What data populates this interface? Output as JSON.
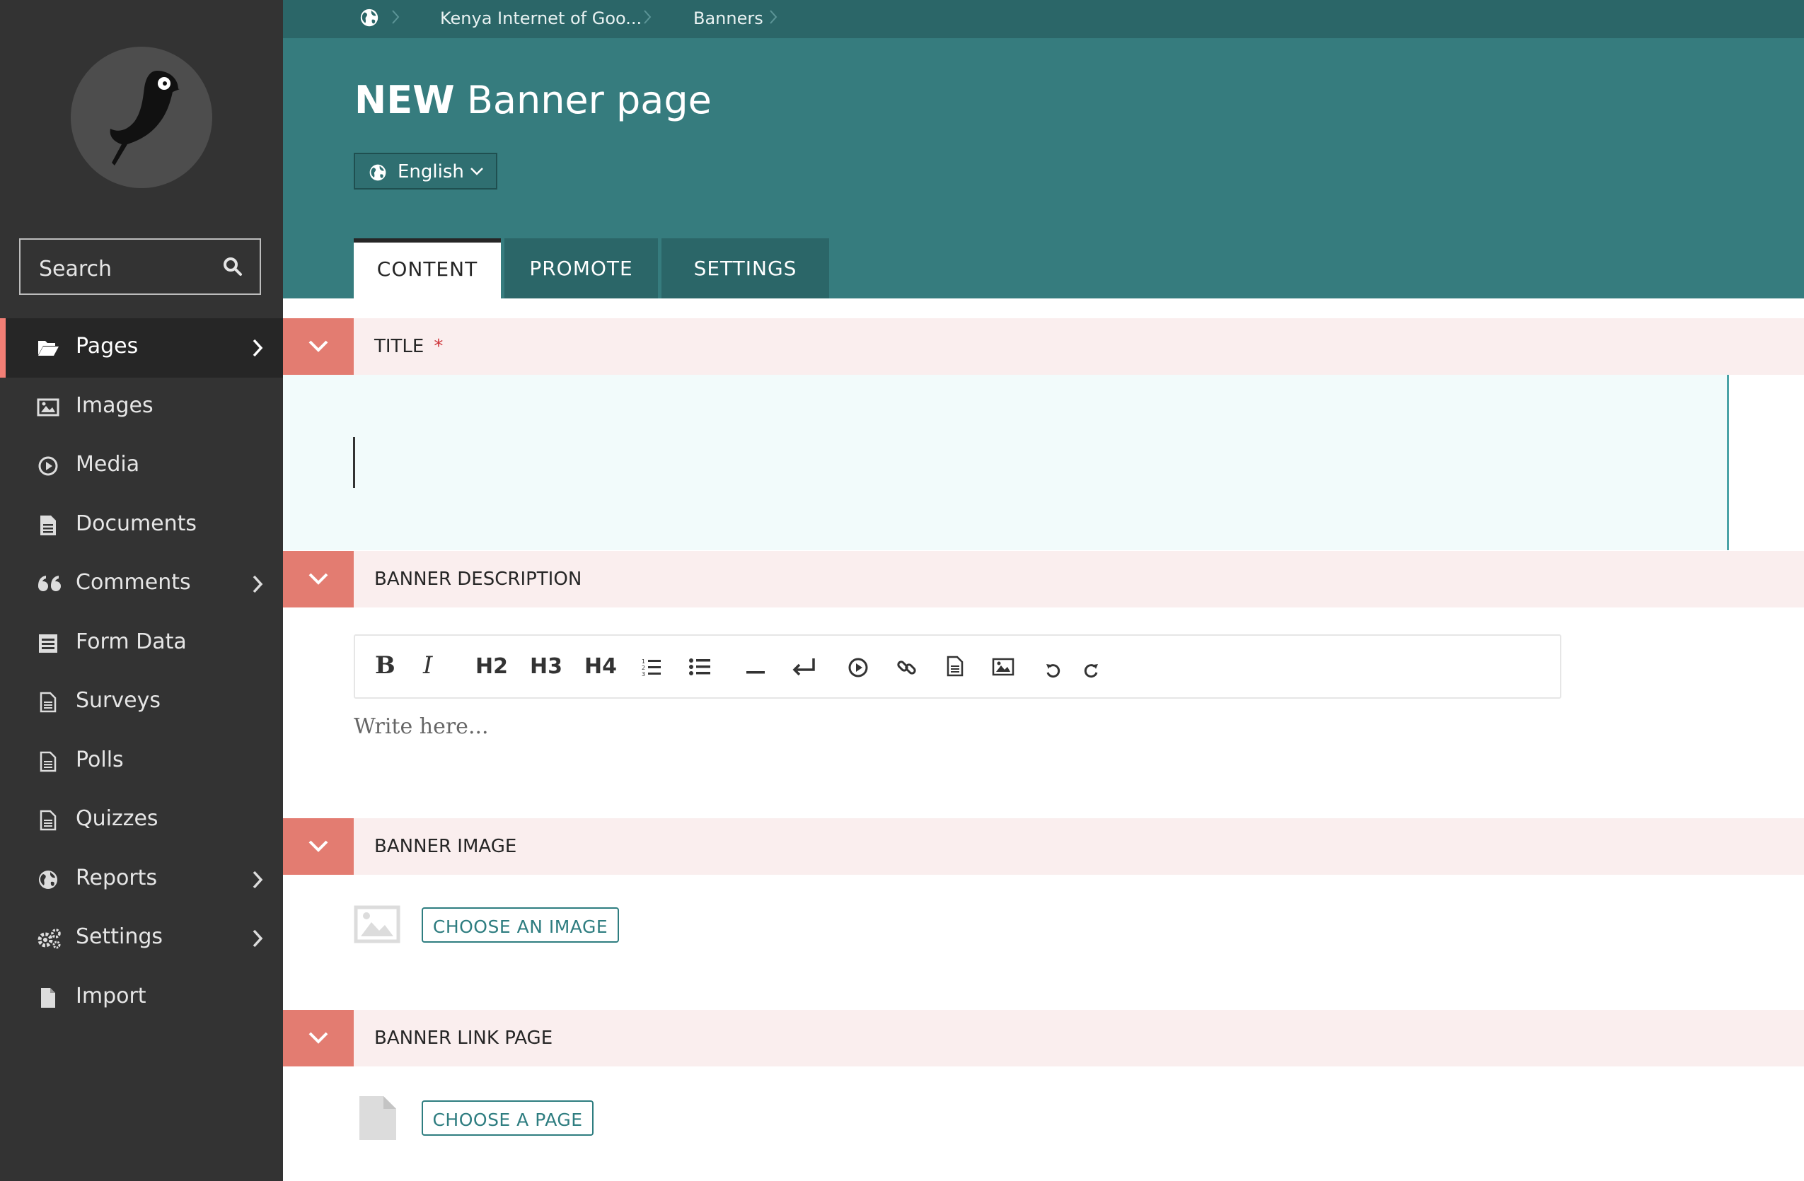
{
  "sidebar": {
    "search_placeholder": "Search",
    "items": [
      {
        "label": "Pages",
        "icon": "folder-open-icon",
        "has_submenu": true,
        "active": true
      },
      {
        "label": "Images",
        "icon": "image-icon"
      },
      {
        "label": "Media",
        "icon": "media-icon"
      },
      {
        "label": "Documents",
        "icon": "document-icon"
      },
      {
        "label": "Comments",
        "icon": "quote-icon",
        "has_submenu": true
      },
      {
        "label": "Form Data",
        "icon": "form-icon"
      },
      {
        "label": "Surveys",
        "icon": "doc-icon"
      },
      {
        "label": "Polls",
        "icon": "doc-icon"
      },
      {
        "label": "Quizzes",
        "icon": "doc-icon"
      },
      {
        "label": "Reports",
        "icon": "globe-icon",
        "has_submenu": true
      },
      {
        "label": "Settings",
        "icon": "cogs-icon",
        "has_submenu": true
      },
      {
        "label": "Import",
        "icon": "file-icon"
      }
    ]
  },
  "breadcrumb": {
    "items": [
      "Kenya Internet of Goo...",
      "Banners"
    ]
  },
  "header": {
    "title_bold": "NEW",
    "title_rest": "Banner page",
    "locale": "English",
    "tabs": [
      "CONTENT",
      "PROMOTE",
      "SETTINGS"
    ]
  },
  "sections": {
    "title": {
      "label": "TITLE",
      "required_marker": "*"
    },
    "description": {
      "label": "BANNER DESCRIPTION",
      "placeholder": "Write here..."
    },
    "image": {
      "label": "BANNER IMAGE",
      "button": "CHOOSE AN IMAGE"
    },
    "link": {
      "label": "BANNER LINK PAGE",
      "button": "CHOOSE A PAGE"
    }
  },
  "toolbar": {
    "bold": "B",
    "italic": "I",
    "h2": "H2",
    "h3": "H3",
    "h4": "H4"
  },
  "colors": {
    "sidebar_bg": "#333333",
    "header_teal": "#367c7e",
    "breadcrumb_teal": "#2b6668",
    "section_toggle": "#e37c71",
    "section_header_bg": "#faeeee",
    "active_nav_border": "#f27e75"
  }
}
